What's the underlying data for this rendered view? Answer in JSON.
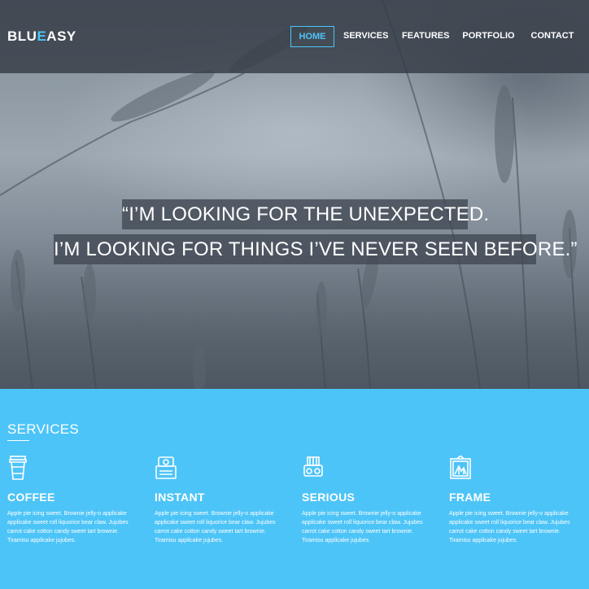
{
  "brand": {
    "logo_part1": "BLU",
    "logo_accent": "E",
    "logo_part2": "ASY"
  },
  "nav": {
    "items": [
      "HOME",
      "SERVICES",
      "FEATURES",
      "PORTFOLIO",
      "CONTACT"
    ],
    "active": "HOME"
  },
  "hero": {
    "quote_line1": "“I’M LOOKING FOR THE UNEXPECTED.",
    "quote_line2": "I’M LOOKING FOR THINGS I’VE NEVER SEEN BEFORE.”"
  },
  "services": {
    "title": "SERVICES",
    "items": [
      {
        "icon": "coffee-cup-icon",
        "title": "COFFEE",
        "text": "Apple pie icing sweet. Brownie jelly-o applicake applicake sweet roll liquorice bear claw. Jujubes carrot cake cotton candy sweet tart brownie. Tiramisu applicake jujubes."
      },
      {
        "icon": "instant-camera-icon",
        "title": "INSTANT",
        "text": "Apple pie icing sweet. Brownie jelly-o applicake applicake sweet roll liquorice bear claw. Jujubes carrot cake cotton candy sweet tart brownie. Tiramisu applicake jujubes."
      },
      {
        "icon": "film-camera-icon",
        "title": "SERIOUS",
        "text": "Apple pie icing sweet. Brownie jelly-o applicake applicake sweet roll liquorice bear claw. Jujubes carrot cake cotton candy sweet tart brownie. Tiramisu applicake jujubes."
      },
      {
        "icon": "picture-frame-icon",
        "title": "FRAME",
        "text": "Apple pie icing sweet. Brownie jelly-o applicake applicake sweet roll liquorice bear claw. Jujubes carrot cake cotton candy sweet tart brownie. Tiramisu applicake jujubes."
      }
    ]
  },
  "colors": {
    "accent": "#4dc4f7",
    "header_bg": "#343c46",
    "quote_bg": "#404852",
    "text": "#ffffff"
  }
}
